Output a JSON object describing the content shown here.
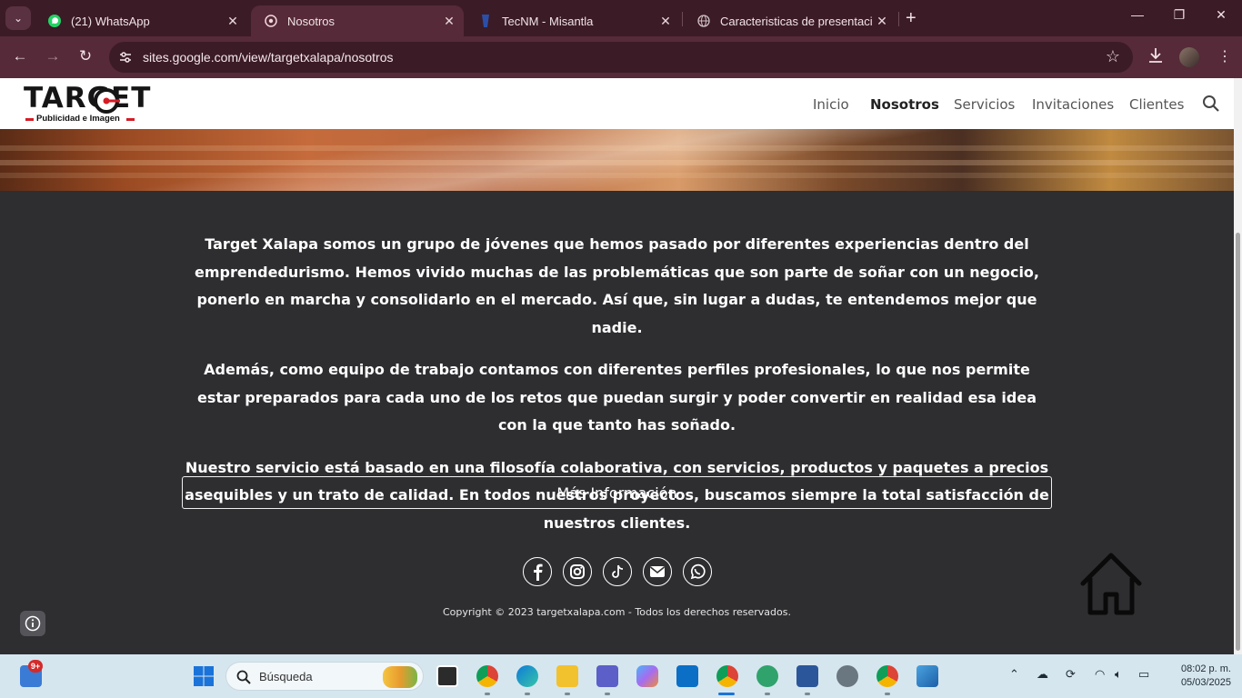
{
  "browser": {
    "tabs": [
      {
        "title": "(21) WhatsApp",
        "icon": "whatsapp-icon",
        "active": false
      },
      {
        "title": "Nosotros",
        "icon": "google-sites-icon",
        "active": true
      },
      {
        "title": "TecNM - Misantla",
        "icon": "tecnm-icon",
        "active": false
      },
      {
        "title": "Caracteristicas de presentacion",
        "icon": "globe-icon",
        "active": false
      }
    ],
    "url": "sites.google.com/view/targetxalapa/nosotros"
  },
  "site": {
    "logo_word": "TARGET",
    "logo_sub": "Publicidad e Imagen",
    "nav": [
      {
        "label": "Inicio",
        "active": false
      },
      {
        "label": "Nosotros",
        "active": true
      },
      {
        "label": "Servicios",
        "active": false
      },
      {
        "label": "Invitaciones",
        "active": false
      },
      {
        "label": "Clientes",
        "active": false
      }
    ],
    "paragraphs": [
      "Target Xalapa somos un grupo de jóvenes que hemos pasado por diferentes experiencias dentro del emprendedurismo. Hemos vivido muchas de las problemáticas que son parte de soñar con un negocio, ponerlo en marcha y consolidarlo en el mercado. Así que, sin lugar a dudas, te entendemos mejor que nadie.",
      "Además, como equipo de trabajo contamos con diferentes perfiles profesionales, lo que nos permite estar preparados para cada uno de los retos que puedan surgir y poder convertir en realidad esa idea con la que tanto has soñado.",
      "Nuestro servicio está basado en una filosofía colaborativa, con servicios, productos y paquetes a precios asequibles y un trato de calidad. En todos nuestros proyectos, buscamos siempre la total satisfacción de nuestros clientes."
    ],
    "more_info_label": "Más Información",
    "social": [
      "facebook-icon",
      "instagram-icon",
      "tiktok-icon",
      "mail-icon",
      "whatsapp-icon"
    ],
    "copyright": "Copyright © 2023 targetxalapa.com - Todos los derechos reservados."
  },
  "taskbar": {
    "search_placeholder": "Búsqueda",
    "notification_badge": "9+",
    "time": "08:02 p. m.",
    "date": "05/03/2025"
  },
  "colors": {
    "chrome_dark": "#3b1b26",
    "chrome_toolbar": "#562a38",
    "page_bg": "#2e2d30",
    "logo_red": "#d51b25"
  }
}
